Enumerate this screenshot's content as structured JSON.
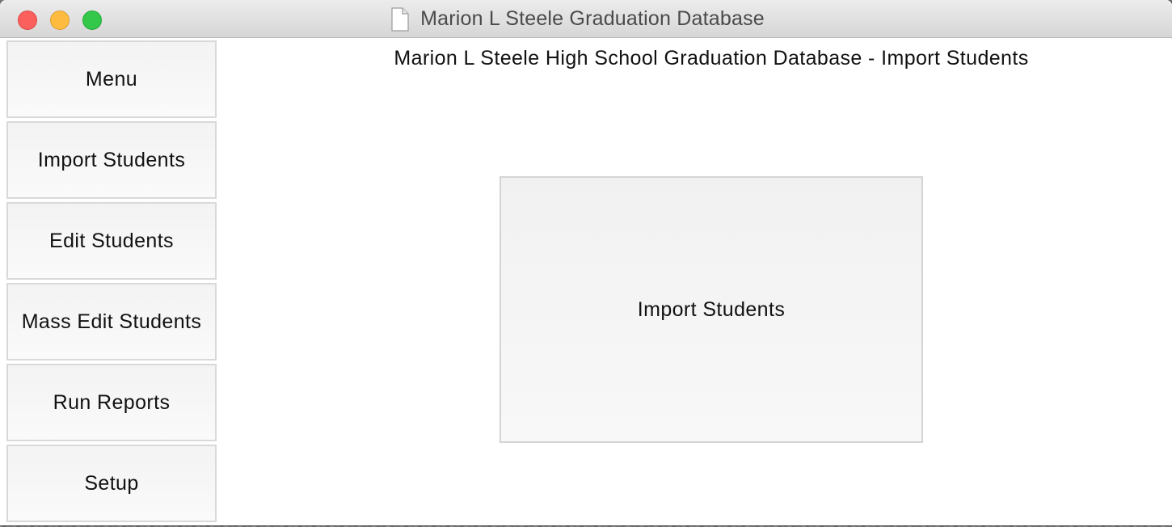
{
  "window": {
    "title": "Marion L Steele Graduation Database",
    "icon": "document-icon"
  },
  "sidebar": {
    "items": [
      {
        "label": "Menu"
      },
      {
        "label": "Import Students"
      },
      {
        "label": "Edit Students"
      },
      {
        "label": "Mass Edit Students"
      },
      {
        "label": "Run Reports"
      },
      {
        "label": "Setup"
      }
    ]
  },
  "main": {
    "title": "Marion L Steele High School Graduation Database - Import Students",
    "import_button_label": "Import Students"
  },
  "colors": {
    "close": "#fc605c",
    "minimize": "#fdbc40",
    "maximize": "#34c84a",
    "button_border": "#d9d9d9",
    "button_bg": "#f5f5f5"
  }
}
